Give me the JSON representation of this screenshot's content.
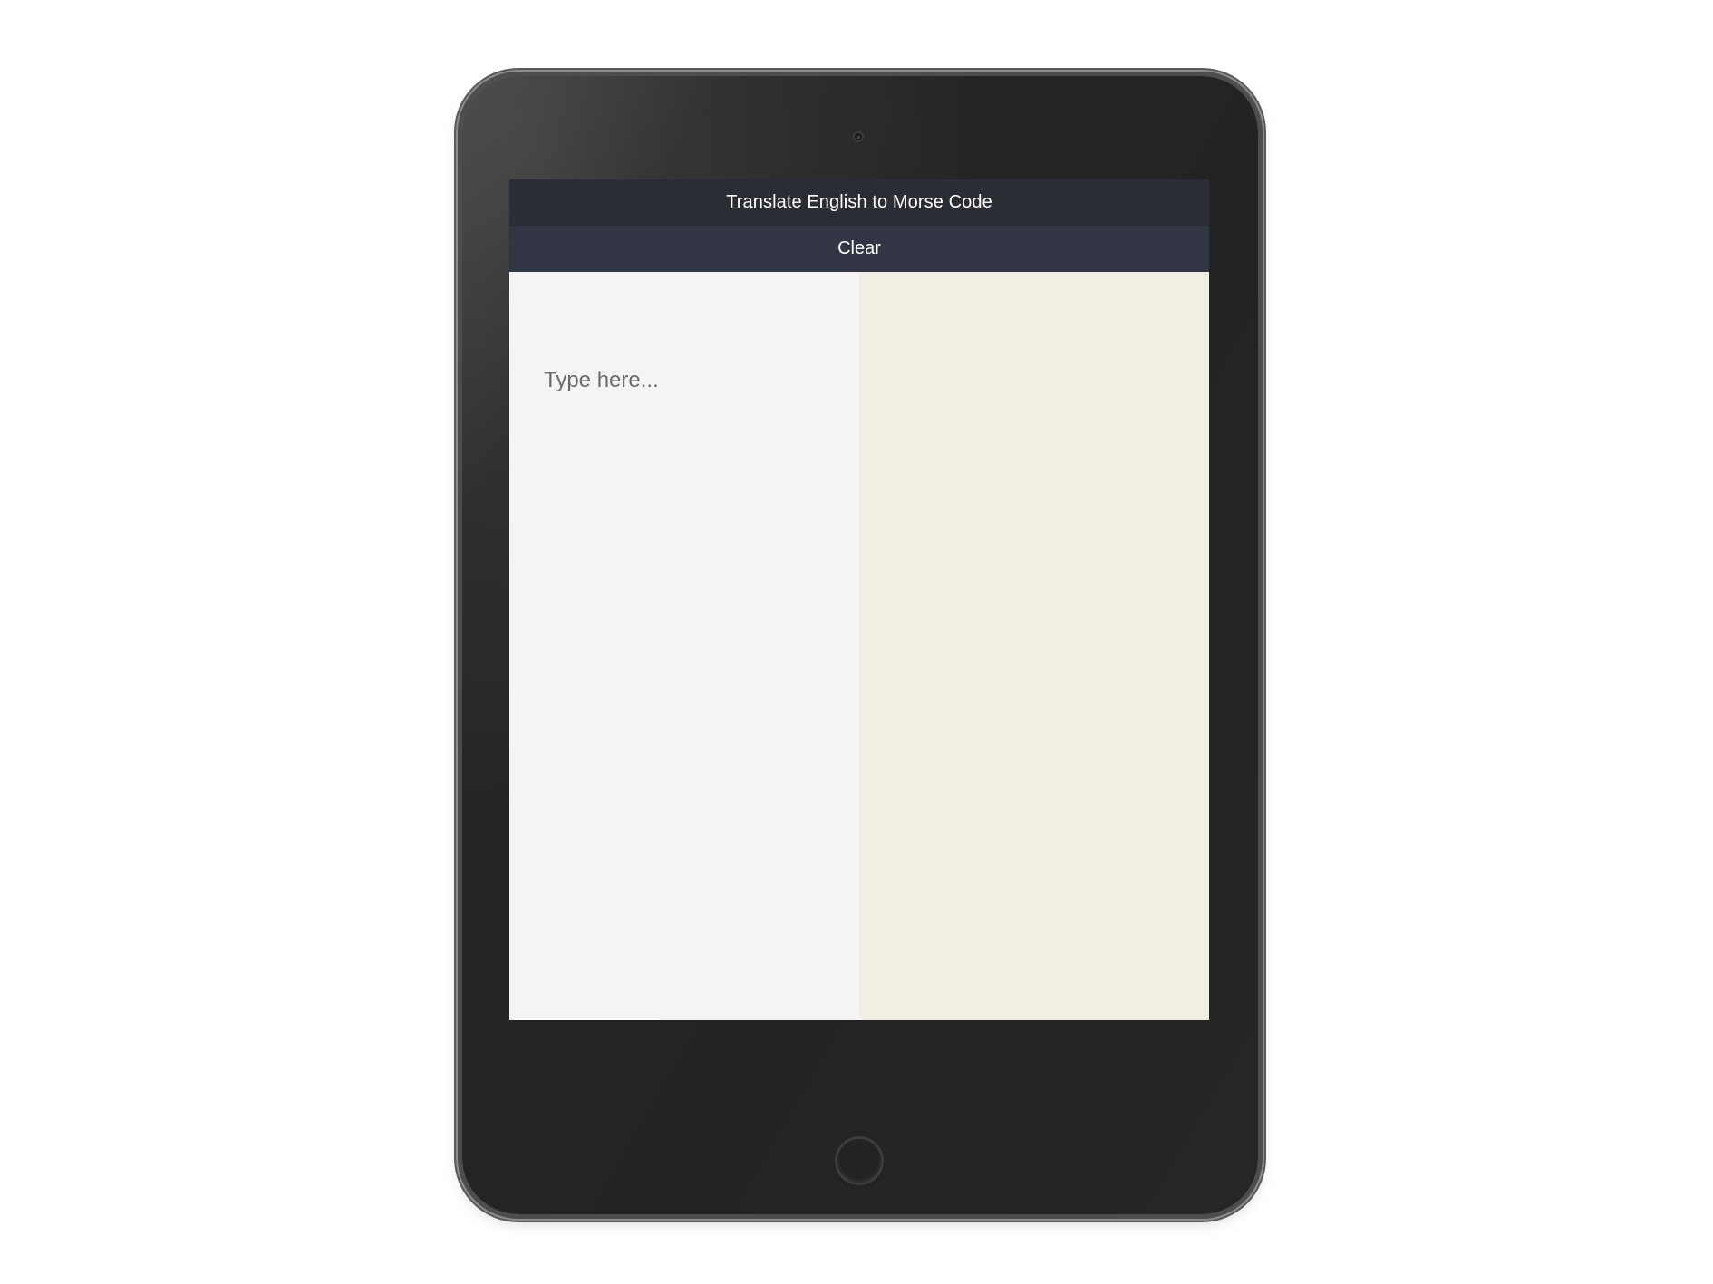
{
  "app": {
    "title": "Translate English to Morse Code",
    "clear_label": "Clear"
  },
  "input": {
    "value": "",
    "placeholder": "Type here..."
  },
  "output": {
    "value": ""
  },
  "colors": {
    "title_bar": "#2a2d34",
    "clear_bar": "#323644",
    "input_pane": "#f4f4f4",
    "output_pane": "#f1eee4",
    "device_body": "#232323"
  },
  "icons": {
    "camera": "camera-icon",
    "home_button": "home-button-icon"
  }
}
